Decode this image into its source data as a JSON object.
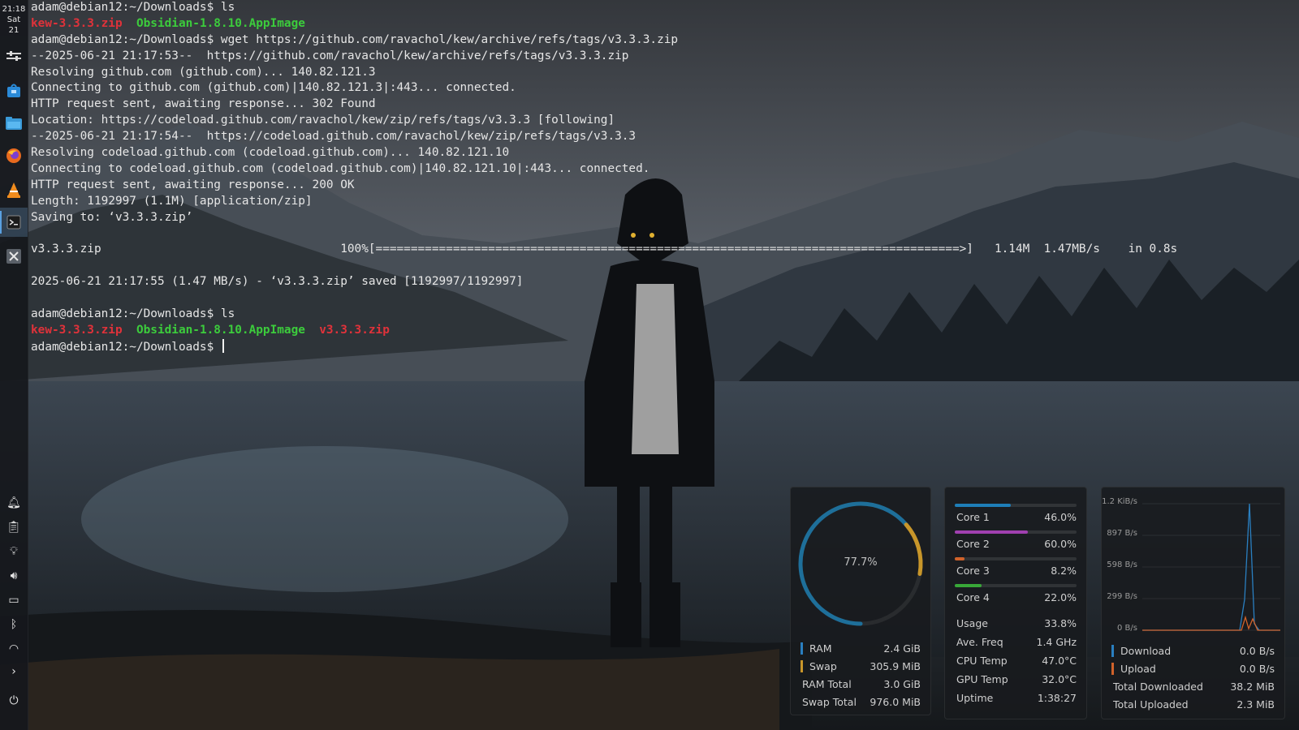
{
  "clock": {
    "time": "21:18",
    "day": "Sat",
    "date": "21"
  },
  "launchers": [
    {
      "name": "system-settings-icon"
    },
    {
      "name": "store-icon"
    },
    {
      "name": "file-manager-icon"
    },
    {
      "name": "firefox-icon"
    },
    {
      "name": "vlc-icon"
    },
    {
      "name": "terminal-icon"
    },
    {
      "name": "x-app-icon"
    }
  ],
  "tray": [
    {
      "name": "notifications-icon",
      "glyph": "🔔︎"
    },
    {
      "name": "clipboard-icon",
      "glyph": "📋︎"
    },
    {
      "name": "night-light-icon",
      "glyph": "💡︎"
    },
    {
      "name": "volume-icon",
      "glyph": "🔊︎"
    },
    {
      "name": "battery-icon",
      "glyph": "▭"
    },
    {
      "name": "bluetooth-icon",
      "glyph": "ᛒ"
    },
    {
      "name": "wifi-icon",
      "glyph": "◠"
    },
    {
      "name": "expand-tray-icon",
      "glyph": "›"
    },
    {
      "name": "power-menu-icon",
      "glyph": "⏻"
    }
  ],
  "terminal": {
    "lines": [
      [
        {
          "t": "adam@debian12:~/Downloads$ ls"
        }
      ],
      [
        {
          "t": "kew-3.3.3.zip",
          "c": "red"
        },
        {
          "t": "  "
        },
        {
          "t": "Obsidian-1.8.10.AppImage",
          "c": "green"
        }
      ],
      [
        {
          "t": "adam@debian12:~/Downloads$ wget https://github.com/ravachol/kew/archive/refs/tags/v3.3.3.zip"
        }
      ],
      [
        {
          "t": "--2025-06-21 21:17:53--  https://github.com/ravachol/kew/archive/refs/tags/v3.3.3.zip"
        }
      ],
      [
        {
          "t": "Resolving github.com (github.com)... 140.82.121.3"
        }
      ],
      [
        {
          "t": "Connecting to github.com (github.com)|140.82.121.3|:443... connected."
        }
      ],
      [
        {
          "t": "HTTP request sent, awaiting response... 302 Found"
        }
      ],
      [
        {
          "t": "Location: https://codeload.github.com/ravachol/kew/zip/refs/tags/v3.3.3 [following]"
        }
      ],
      [
        {
          "t": "--2025-06-21 21:17:54--  https://codeload.github.com/ravachol/kew/zip/refs/tags/v3.3.3"
        }
      ],
      [
        {
          "t": "Resolving codeload.github.com (codeload.github.com)... 140.82.121.10"
        }
      ],
      [
        {
          "t": "Connecting to codeload.github.com (codeload.github.com)|140.82.121.10|:443... connected."
        }
      ],
      [
        {
          "t": "HTTP request sent, awaiting response... 200 OK"
        }
      ],
      [
        {
          "t": "Length: 1192997 (1.1M) [application/zip]"
        }
      ],
      [
        {
          "t": "Saving to: ‘v3.3.3.zip’"
        }
      ],
      [
        {
          "t": ""
        }
      ],
      [
        {
          "t": "v3.3.3.zip                                  100%[===================================================================================>]   1.14M  1.47MB/s    in 0.8s"
        }
      ],
      [
        {
          "t": ""
        }
      ],
      [
        {
          "t": "2025-06-21 21:17:55 (1.47 MB/s) - ‘v3.3.3.zip’ saved [1192997/1192997]"
        }
      ],
      [
        {
          "t": ""
        }
      ],
      [
        {
          "t": "adam@debian12:~/Downloads$ ls"
        }
      ],
      [
        {
          "t": "kew-3.3.3.zip",
          "c": "red"
        },
        {
          "t": "  "
        },
        {
          "t": "Obsidian-1.8.10.AppImage",
          "c": "green"
        },
        {
          "t": "  "
        },
        {
          "t": "v3.3.3.zip",
          "c": "red"
        }
      ],
      [
        {
          "t": "adam@debian12:~/Downloads$ ",
          "cursor": true
        }
      ]
    ]
  },
  "memory": {
    "gauge_value": "77.7%",
    "gauge_fraction": 0.777,
    "rows": [
      {
        "label": "RAM",
        "value": "2.4 GiB",
        "marker": "#2a7fc0"
      },
      {
        "label": "Swap",
        "value": "305.9 MiB",
        "marker": "#c8962a"
      },
      {
        "label": "RAM Total",
        "value": "3.0 GiB"
      },
      {
        "label": "Swap Total",
        "value": "976.0 MiB"
      }
    ]
  },
  "cpu": {
    "cores": [
      {
        "label": "Core 1",
        "value": "46.0%",
        "fraction": 0.46,
        "color": "#1e7eb8"
      },
      {
        "label": "Core 2",
        "value": "60.0%",
        "fraction": 0.6,
        "color": "#a040b0"
      },
      {
        "label": "Core 3",
        "value": "8.2%",
        "fraction": 0.082,
        "color": "#d0622a"
      },
      {
        "label": "Core 4",
        "value": "22.0%",
        "fraction": 0.22,
        "color": "#38a838"
      }
    ],
    "stats": [
      {
        "label": "Usage",
        "value": "33.8%"
      },
      {
        "label": "Ave. Freq",
        "value": "1.4 GHz"
      },
      {
        "label": "CPU Temp",
        "value": "47.0°C"
      },
      {
        "label": "GPU Temp",
        "value": "32.0°C"
      },
      {
        "label": "Uptime",
        "value": "1:38:27"
      }
    ]
  },
  "network": {
    "axis_labels": [
      "1.2 KiB/s",
      "897 B/s",
      "598 B/s",
      "299 B/s",
      "0 B/s"
    ],
    "rows": [
      {
        "label": "Download",
        "value": "0.0 B/s",
        "marker": "#2a7fc0"
      },
      {
        "label": "Upload",
        "value": "0.0 B/s",
        "marker": "#d0622a"
      },
      {
        "label": "Total Downloaded",
        "value": "38.2 MiB"
      },
      {
        "label": "Total Uploaded",
        "value": "2.3 MiB"
      }
    ],
    "colors": {
      "download": "#2a7fc0",
      "upload": "#d0622a"
    }
  }
}
